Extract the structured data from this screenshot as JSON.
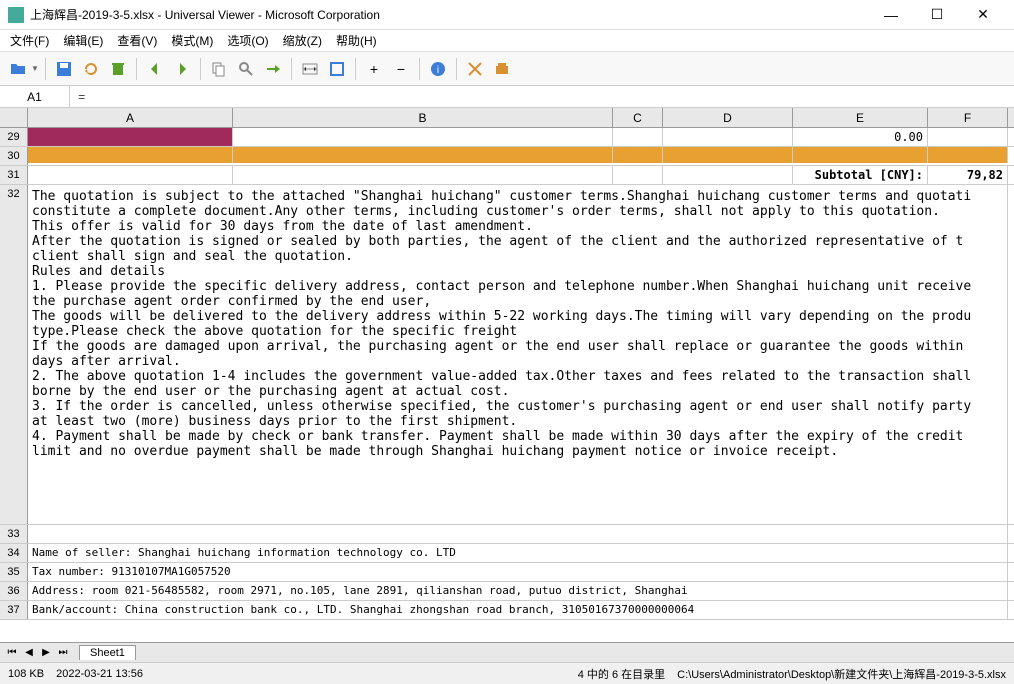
{
  "title": "上海辉昌-2019-3-5.xlsx - Universal Viewer - Microsoft Corporation",
  "menu": {
    "file": "文件(F)",
    "edit": "编辑(E)",
    "view": "查看(V)",
    "mode": "模式(M)",
    "options": "选项(O)",
    "zoom": "缩放(Z)",
    "help": "帮助(H)"
  },
  "formula": {
    "cell": "A1",
    "fx": "="
  },
  "cols": [
    "A",
    "B",
    "C",
    "D",
    "E",
    "F"
  ],
  "rows": {
    "r29": {
      "e": "0.00"
    },
    "r31": {
      "e": "Subtotal [CNY]:",
      "f": "79,82"
    },
    "r32": "The quotation is subject to the attached \"Shanghai huichang\" customer terms.Shanghai huichang customer terms and quotati\nconstitute a complete document.Any other terms, including customer's order terms, shall not apply to this quotation.\nThis offer is valid for 30 days from the date of last amendment.\nAfter the quotation is signed or sealed by both parties, the agent of the client and the authorized representative of t\nclient shall sign and seal the quotation.\nRules and details\n1. Please provide the specific delivery address, contact person and telephone number.When Shanghai huichang unit receive\nthe purchase agent order confirmed by the end user,\nThe goods will be delivered to the delivery address within 5-22 working days.The timing will vary depending on the produ\ntype.Please check the above quotation for the specific freight\nIf the goods are damaged upon arrival, the purchasing agent or the end user shall replace or guarantee the goods within \ndays after arrival.\n2. The above quotation 1-4 includes the government value-added tax.Other taxes and fees related to the transaction shall\nborne by the end user or the purchasing agent at actual cost.\n3. If the order is cancelled, unless otherwise specified, the customer's purchasing agent or end user shall notify party\nat least two (more) business days prior to the first shipment.\n4. Payment shall be made by check or bank transfer. Payment shall be made within 30 days after the expiry of the credit \nlimit and no overdue payment shall be made through Shanghai huichang payment notice or invoice receipt.",
    "r34": "Name of seller: Shanghai huichang information technology co. LTD",
    "r35": "Tax number: 91310107MA1G057520",
    "r36": "Address: room 021-56485582, room 2971, no.105, lane 2891, qilianshan road, putuo district, Shanghai",
    "r37": "Bank/account: China construction bank co., LTD. Shanghai zhongshan road branch, 31050167370000000064"
  },
  "sheet_tab": "Sheet1",
  "status": {
    "size": "108 KB",
    "date": "2022-03-21 13:56",
    "pos": "4 中的 6 在目录里",
    "path": "C:\\Users\\Administrator\\Desktop\\新建文件夹\\上海辉昌-2019-3-5.xlsx"
  }
}
